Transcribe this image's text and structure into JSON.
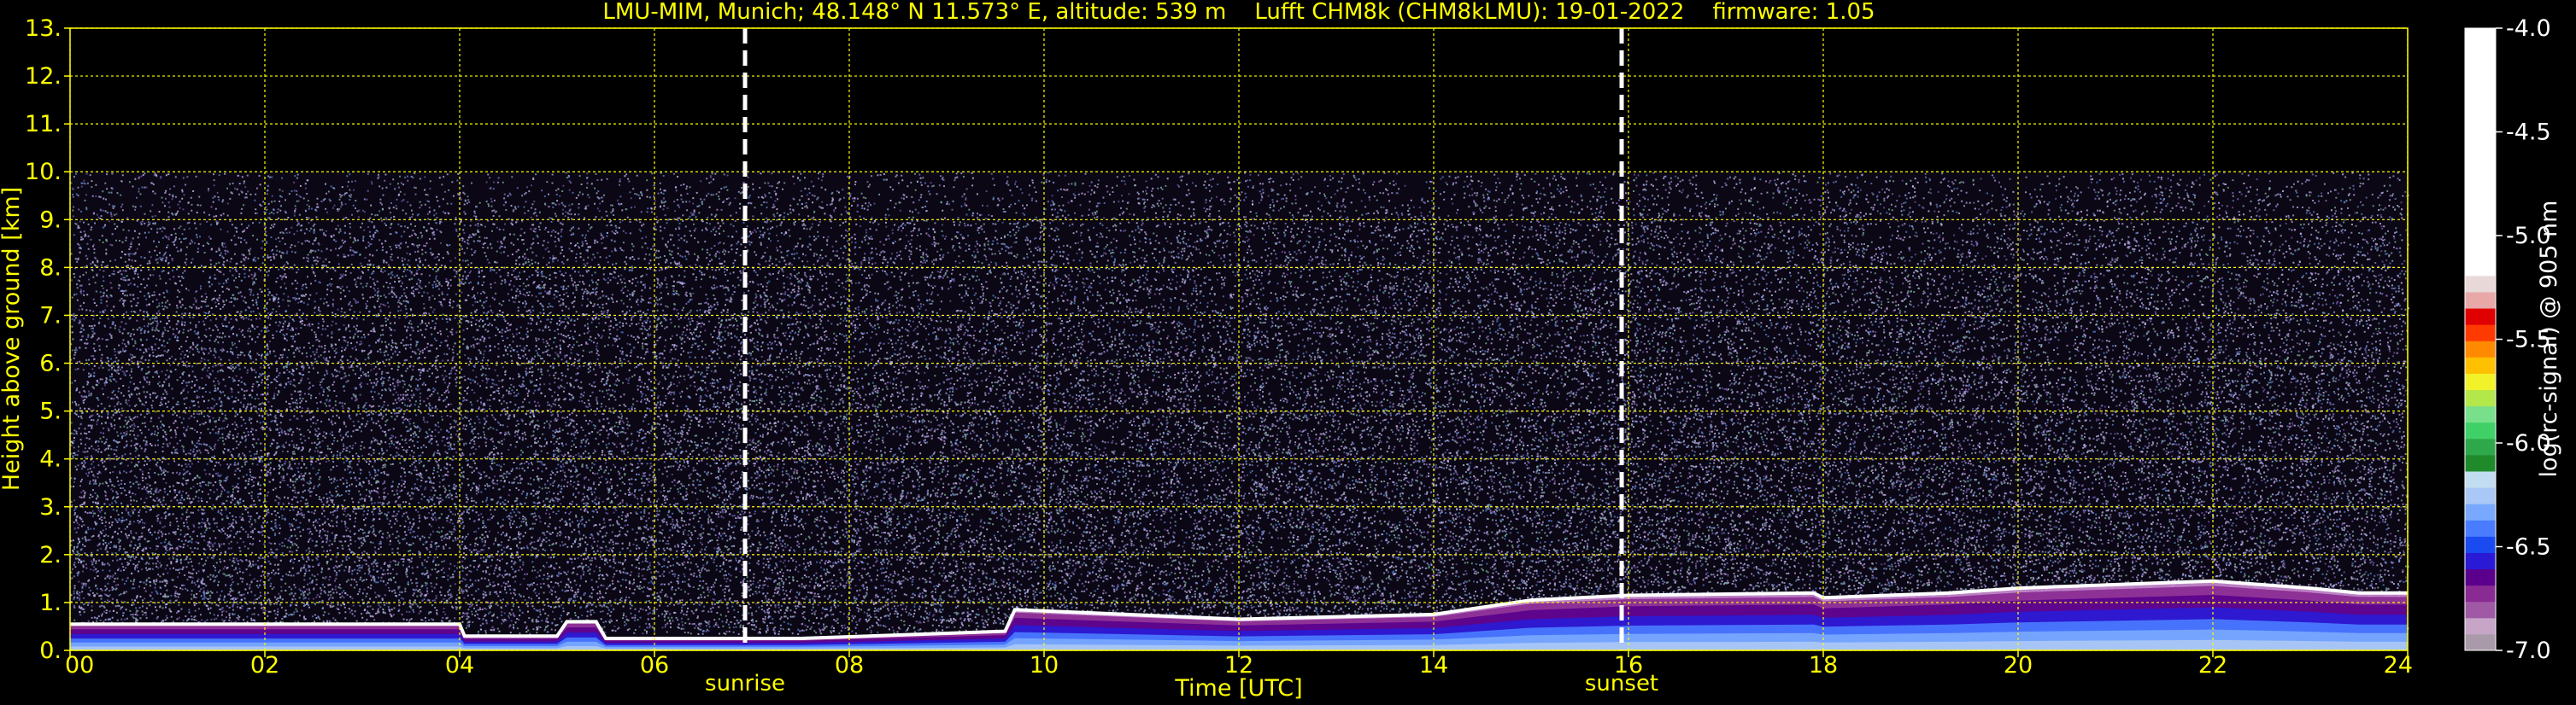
{
  "chart_data": {
    "type": "heatmap",
    "title": "LMU-MIM, Munich; 48.148° N 11.573° E, altitude: 539 m    Lufft CHM8k (CHM8kLMU): 19-01-2022    firmware: 1.05",
    "xlabel": "Time [UTC]",
    "ylabel": "Height above ground [km]",
    "colorbar_label": "log(rc-signal) @ 905 nm",
    "xlim": [
      0,
      24
    ],
    "ylim": [
      0,
      13
    ],
    "x_ticks": [
      "00",
      "02",
      "04",
      "06",
      "08",
      "10",
      "12",
      "14",
      "16",
      "18",
      "20",
      "22",
      "24"
    ],
    "y_ticks": [
      "0.",
      "1.",
      "2.",
      "3.",
      "4.",
      "5.",
      "6.",
      "7.",
      "8.",
      "9.",
      "10.",
      "11.",
      "12.",
      "13."
    ],
    "colorbar_range": [
      -7.0,
      -4.0
    ],
    "colorbar_ticks": [
      "-4.0",
      "-4.5",
      "-5.0",
      "-5.5",
      "-6.0",
      "-6.5",
      "-7.0"
    ],
    "grid": true,
    "noise_top_km": 10,
    "annotations": [
      {
        "label": "sunrise",
        "x": 6.93
      },
      {
        "label": "sunset",
        "x": 15.93
      }
    ],
    "boundary_layer_top_km": [
      {
        "x": 0.0,
        "y": 0.55
      },
      {
        "x": 4.0,
        "y": 0.55
      },
      {
        "x": 4.05,
        "y": 0.3
      },
      {
        "x": 5.0,
        "y": 0.3
      },
      {
        "x": 5.1,
        "y": 0.6
      },
      {
        "x": 5.4,
        "y": 0.6
      },
      {
        "x": 5.5,
        "y": 0.25
      },
      {
        "x": 7.5,
        "y": 0.25
      },
      {
        "x": 9.6,
        "y": 0.4
      },
      {
        "x": 9.7,
        "y": 0.85
      },
      {
        "x": 12.0,
        "y": 0.65
      },
      {
        "x": 14.0,
        "y": 0.75
      },
      {
        "x": 15.0,
        "y": 1.05
      },
      {
        "x": 16.0,
        "y": 1.15
      },
      {
        "x": 17.9,
        "y": 1.2
      },
      {
        "x": 18.0,
        "y": 1.1
      },
      {
        "x": 19.3,
        "y": 1.2
      },
      {
        "x": 20.0,
        "y": 1.3
      },
      {
        "x": 22.0,
        "y": 1.45
      },
      {
        "x": 23.0,
        "y": 1.3
      },
      {
        "x": 23.5,
        "y": 1.2
      },
      {
        "x": 24.0,
        "y": 1.2
      }
    ],
    "colors": {
      "axes": "#ffff00",
      "grid": "#ffff00",
      "background": "#000000",
      "sun_lines": "#ffffff"
    },
    "colormap": [
      "#a89aa8",
      "#c6a5c6",
      "#a05aa5",
      "#8a2a93",
      "#5a008c",
      "#2a1ad6",
      "#1a4bf0",
      "#4a7cff",
      "#79a8ff",
      "#aac8f5",
      "#c2ddf0",
      "#1f8a2a",
      "#2ea84a",
      "#3fd068",
      "#78e08a",
      "#b4e84a",
      "#f2f22a",
      "#ffc000",
      "#ff8a00",
      "#ff3a00",
      "#e00000",
      "#e8a8a8",
      "#e8d8d8",
      "#ffffff"
    ]
  }
}
